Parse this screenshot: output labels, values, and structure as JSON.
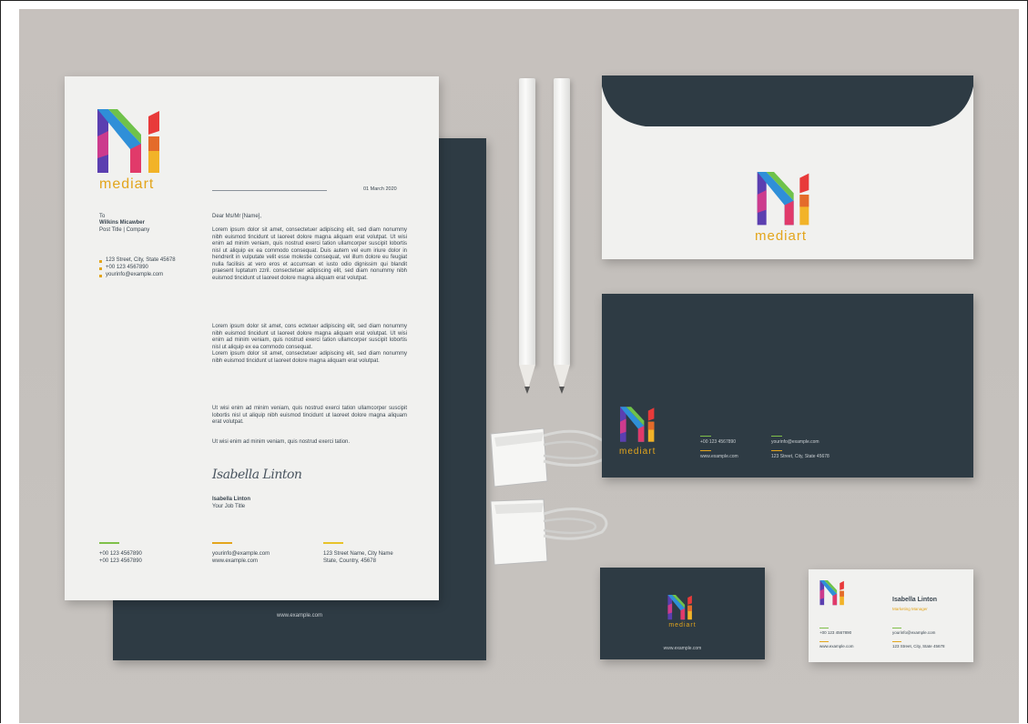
{
  "brand": {
    "name": "mediart",
    "accent": "#e3a51c",
    "dark": "#2e3b44"
  },
  "letterhead": {
    "date": "01 March 2020",
    "to_label": "To",
    "recipient_name": "Wilkins Micawber",
    "recipient_title": "Post Title | Company",
    "address": "123 Street, City, State 45678",
    "phone": "+00 123 4567890",
    "email": "yourinfo@example.com",
    "greeting": "Dear Ms/Mr [Name],",
    "para1": "Lorem ipsum dolor sit amet, consectetuer adipiscing elit, sed diam nonummy nibh euismod tincidunt ut laoreet dolore magna aliquam erat volutpat. Ut wisi enim ad minim veniam, quis nostrud exerci tation ullamcorper suscipit lobortis nisl ut aliquip ex ea commodo consequat. Duis autem vel eum iriure dolor in hendrerit in vulputate velit esse molestie consequat, vel illum dolore eu feugiat nulla facilisis at vero eros et accumsan et iusto odio dignissim qui blandit praesent luptatum zzril. consectetuer adipiscing elit, sed diam nonummy nibh euismod tincidunt ut laoreet dolore magna aliquam erat volutpat.",
    "para2": "Lorem ipsum dolor sit amet, cons ectetuer adipiscing elit, sed diam nonummy nibh euismod tincidunt ut laoreet dolore magna aliquam erat volutpat. Ut wisi enim ad minim veniam, quis nostrud exerci tation ullamcorper suscipit lobortis nisl ut aliquip ex ea commodo consequat.\nLorem ipsum dolor sit amet, consectetuer adipiscing elit, sed diam nonummy nibh euismod tincidunt ut laoreet dolore magna aliquam erat volutpat.",
    "para3": "Ut wisi enim ad minim veniam, quis nostrud exerci tation ullamcorper suscipit lobortis nisl ut aliquip nibh euismod tincidunt ut laoreet dolore magna aliquam erat volutpat.",
    "para4": "Ut wisi enim ad minim veniam, quis nostrud exerci tation.",
    "signature": "Isabella Linton",
    "signer_name": "Isabella Linton",
    "signer_title": "Your Job Title",
    "footer_phone1": "+00 123 4567890",
    "footer_phone2": "+00 123 4567890",
    "footer_email": "yourinfo@example.com",
    "footer_web": "www.example.com",
    "footer_addr1": "123 Street Name, City Name",
    "footer_addr2": "State, Country, 45678"
  },
  "folder": {
    "website": "www.example.com"
  },
  "envelope_back": {
    "phone": "+00 123 4567890",
    "email": "yourinfo@example.com",
    "web": "www.example.com",
    "address": "123 Street, City, State 45678"
  },
  "card_front": {
    "website": "www.example.com"
  },
  "card_back": {
    "name": "Isabella Linton",
    "title": "Marketing Manager",
    "phone": "+00 123 4567890",
    "email": "yourinfo@example.com",
    "web": "www.example.com",
    "address": "123 Street, City, State 45678"
  }
}
